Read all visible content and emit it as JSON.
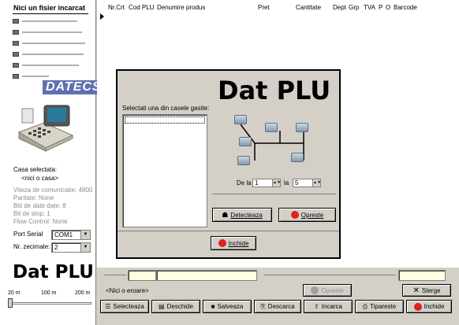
{
  "sidebar": {
    "file_status": "Nici un fisier incarcat",
    "logo_text": "DATECS",
    "casa_label": "Casa selectata:",
    "casa_value": "<nici o casa>",
    "comm_info": [
      "Viteza de comunicatie: 4800",
      "Paritate: None",
      "Biti de date date: 8",
      "Bit de stop: 1",
      "Flow Control: None"
    ],
    "port_label": "Port Serial",
    "port_value": "COM1",
    "decimals_label": "Nr. zecimale:",
    "decimals_value": "2",
    "big_title": "Dat PLU",
    "scale_labels": [
      "20 m",
      "100 m",
      "200 m"
    ],
    "slider_level": 0.0
  },
  "table": {
    "columns": [
      "Nr.Crt",
      "Cod PLU",
      "Denumire produs",
      "Pret",
      "Cantitate",
      "Dept",
      "Grp",
      "TVA",
      "P",
      "O",
      "Barcode"
    ]
  },
  "dialog": {
    "title": "Dat PLU",
    "prompt": "Selectati una din casele gasite:",
    "range_from_label": "De la",
    "range_from_value": "1",
    "range_to_label": "la",
    "range_to_value": "5",
    "detect_button": "Detecteaza",
    "stop_button": "Opreste",
    "close_button": "Inchide"
  },
  "footer": {
    "status": "<Nici o eroare>",
    "stop_button": "Opreste",
    "delete_button": "Sterge",
    "toolbar": [
      "Selecteaza",
      "Deschide",
      "Salveaza",
      "Descarca",
      "Incarca",
      "Tipareste",
      "Inchide"
    ]
  },
  "colors": {
    "stop_red": "#e02020",
    "panel": "#d4d0c8",
    "yellow_field": "#ffffe0"
  }
}
